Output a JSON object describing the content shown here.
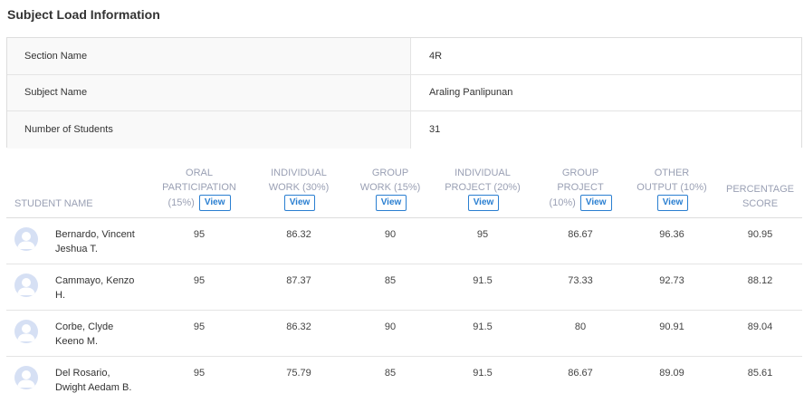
{
  "page_title": "Subject Load Information",
  "info": [
    {
      "label": "Section Name",
      "value": "4R"
    },
    {
      "label": "Subject Name",
      "value": "Araling Panlipunan"
    },
    {
      "label": "Number of Students",
      "value": "31"
    }
  ],
  "columns": {
    "student_name": "STUDENT NAME",
    "oral": {
      "line1": "ORAL",
      "line2": "PARTICIPATION",
      "line3": "(15%)",
      "view": "View"
    },
    "individual_work": {
      "line1": "INDIVIDUAL",
      "line2": "WORK (30%)",
      "view": "View"
    },
    "group_work": {
      "line1": "GROUP",
      "line2": "WORK (15%)",
      "view": "View"
    },
    "individual_project": {
      "line1": "INDIVIDUAL",
      "line2": "PROJECT (20%)",
      "view": "View"
    },
    "group_project": {
      "line1": "GROUP",
      "line2": "PROJECT",
      "line3": "(10%)",
      "view": "View"
    },
    "other_output": {
      "line1": "OTHER",
      "line2": "OUTPUT (10%)",
      "view": "View"
    },
    "percentage": {
      "line1": "PERCENTAGE",
      "line2": "SCORE"
    }
  },
  "students": [
    {
      "name1": "Bernardo, Vincent",
      "name2": "Jeshua T.",
      "oral": "95",
      "iw": "86.32",
      "gw": "90",
      "ip": "95",
      "gp": "86.67",
      "oo": "96.36",
      "ps": "90.95"
    },
    {
      "name1": "Cammayo, Kenzo",
      "name2": "H.",
      "oral": "95",
      "iw": "87.37",
      "gw": "85",
      "ip": "91.5",
      "gp": "73.33",
      "oo": "92.73",
      "ps": "88.12"
    },
    {
      "name1": "Corbe, Clyde",
      "name2": "Keeno M.",
      "oral": "95",
      "iw": "86.32",
      "gw": "90",
      "ip": "91.5",
      "gp": "80",
      "oo": "90.91",
      "ps": "89.04"
    },
    {
      "name1": "Del Rosario,",
      "name2": "Dwight Aedam B.",
      "oral": "95",
      "iw": "75.79",
      "gw": "85",
      "ip": "91.5",
      "gp": "86.67",
      "oo": "89.09",
      "ps": "85.61"
    }
  ]
}
